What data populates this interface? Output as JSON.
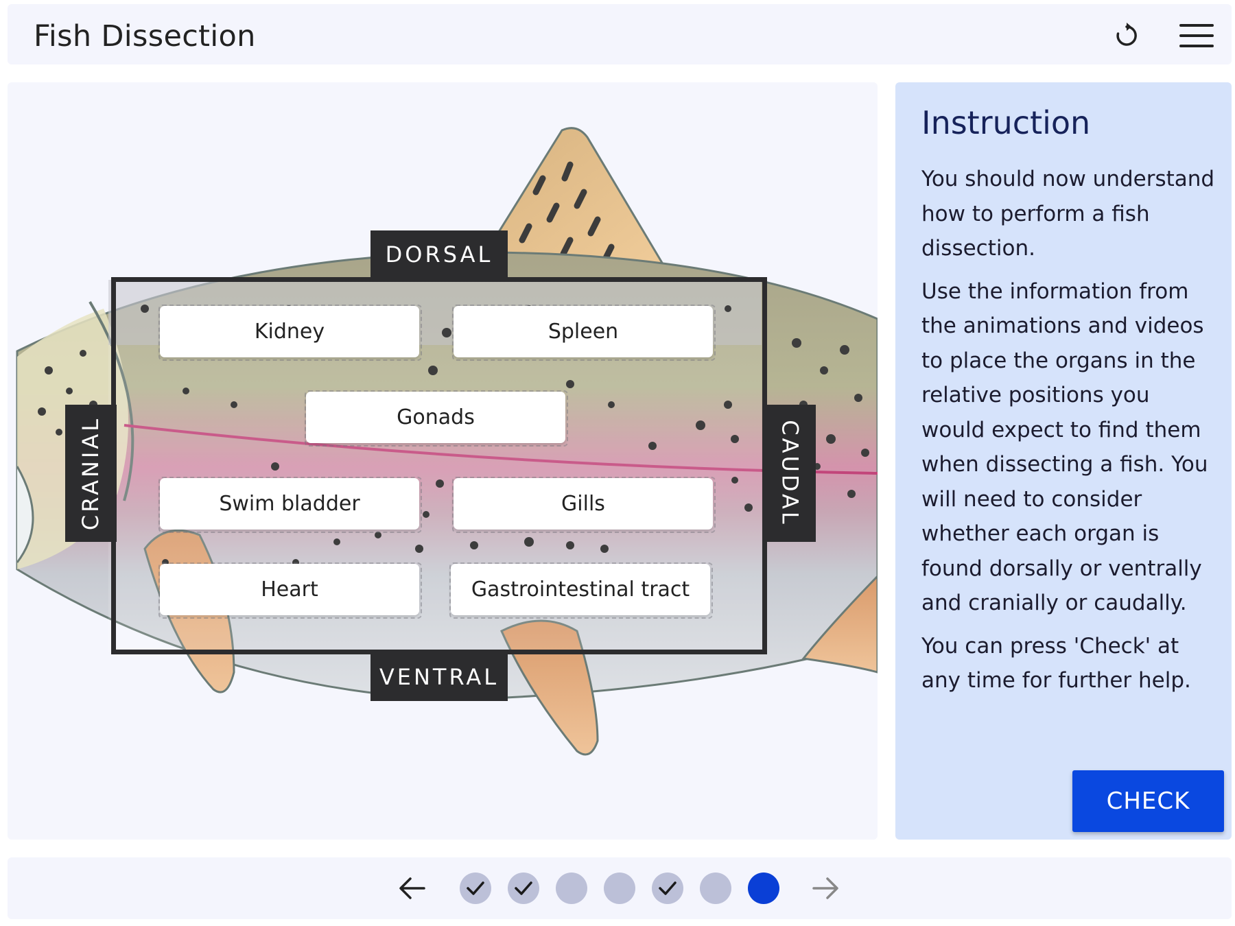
{
  "header": {
    "title": "Fish Dissection",
    "reset_icon": "reset-icon",
    "menu_icon": "hamburger-menu-icon"
  },
  "orientation": {
    "dorsal": "DORSAL",
    "ventral": "VENTRAL",
    "cranial": "CRANIAL",
    "caudal": "CAUDAL"
  },
  "organs": [
    {
      "label": "Kidney"
    },
    {
      "label": "Spleen"
    },
    {
      "label": "Gonads"
    },
    {
      "label": "Swim bladder"
    },
    {
      "label": "Gills"
    },
    {
      "label": "Heart"
    },
    {
      "label": "Gastrointestinal tract"
    }
  ],
  "instruction": {
    "title": "Instruction",
    "paragraphs": [
      "You should now understand how to perform a fish dissection.",
      "Use the information from the animations and videos to place the organs in the relative positions you would expect to find them when dissecting a fish. You will need to consider whether each organ is found dorsally or ventrally and cranially or caudally.",
      "You can press 'Check' at any time for further help."
    ],
    "check_label": "CHECK"
  },
  "navigation": {
    "prev_icon": "arrow-left-icon",
    "next_icon": "arrow-right-icon",
    "steps": [
      {
        "state": "completed"
      },
      {
        "state": "completed"
      },
      {
        "state": "incomplete"
      },
      {
        "state": "incomplete"
      },
      {
        "state": "completed"
      },
      {
        "state": "incomplete"
      },
      {
        "state": "current"
      }
    ]
  },
  "colors": {
    "accent": "#0a48e0",
    "current_step": "#0a3fd6",
    "step_idle": "#bcc0d8",
    "panel_bg": "#d6e3fb",
    "label_bg": "#2c2c2e"
  }
}
